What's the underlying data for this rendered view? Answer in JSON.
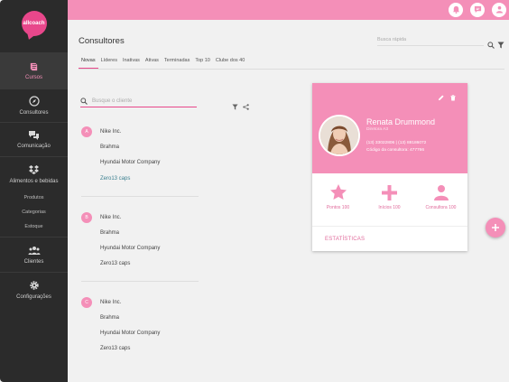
{
  "sidebar": {
    "logo_text": "allcoach",
    "items": [
      {
        "label": "Cursos"
      },
      {
        "label": "Consultores"
      },
      {
        "label": "Comunicação"
      },
      {
        "label": "Alimentos e bebidas"
      },
      {
        "label": "Clientes"
      },
      {
        "label": "Configurações"
      }
    ],
    "subitems": [
      {
        "label": "Produtos"
      },
      {
        "label": "Categorias"
      },
      {
        "label": "Estoque"
      }
    ]
  },
  "header": {
    "title": "Consultores",
    "quick_search_placeholder": "Busca rápida"
  },
  "tabs": [
    {
      "label": "Novas"
    },
    {
      "label": "Líderes"
    },
    {
      "label": "Inativas"
    },
    {
      "label": "Ativas"
    },
    {
      "label": "Terminadas"
    },
    {
      "label": "Top 10"
    },
    {
      "label": "Clube dos 40"
    }
  ],
  "client_search": {
    "placeholder": "Busque o cliente"
  },
  "groups": [
    {
      "letter": "A",
      "items": [
        "Nike Inc.",
        "Brahma",
        "Hyundai Motor Company",
        "Zero13 caps"
      ]
    },
    {
      "letter": "B",
      "items": [
        "Nike Inc.",
        "Brahma",
        "Hyundai Motor Company",
        "Zero13 caps"
      ]
    },
    {
      "letter": "C",
      "items": [
        "Nike Inc.",
        "Brahma",
        "Hyundai Motor Company",
        "Zero13 caps"
      ]
    }
  ],
  "consultant": {
    "name": "Renata Drummond",
    "role": "Diretora A3",
    "phones": "(13) 33022806 | (13) 88186072",
    "code": "Código da consultora: 477766",
    "stats": [
      {
        "label": "Pontos 100",
        "icon": "star-icon"
      },
      {
        "label": "Inícios 100",
        "icon": "plus-icon"
      },
      {
        "label": "Consultora 100",
        "icon": "person-icon"
      }
    ],
    "stats_link": "ESTATÍSTICAS"
  },
  "colors": {
    "accent": "#f48fb8",
    "accent_dark": "#e8478b",
    "sidebar": "#2b2b2b",
    "link": "#3a7f8f"
  }
}
